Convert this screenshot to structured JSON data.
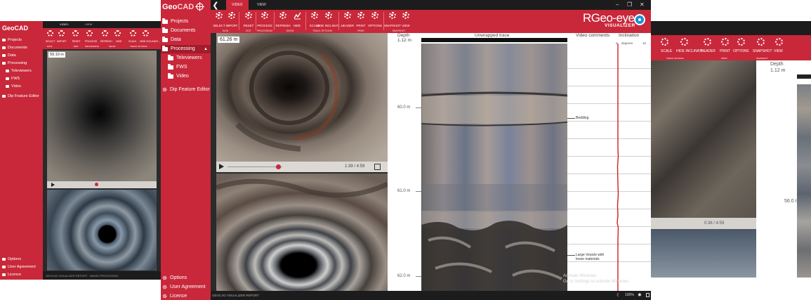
{
  "colors": {
    "brand_red": "#c8283a",
    "dark_bg": "#2b2b2b",
    "accent_blue": "#1e8fd6"
  },
  "left_window": {
    "logo": "GeoCAD",
    "nav": [
      "Projects",
      "Documents",
      "Data",
      "Processing",
      "Televiewers",
      "FWS",
      "Video",
      "Dip Feature Editor",
      "Options",
      "User Agreement",
      "Licence"
    ],
    "tabs": [
      "VIDEO",
      "VIEW"
    ],
    "toolbar": [
      "SELECT",
      "IMPORT",
      "RESET",
      "PROCESS",
      "REFRESH",
      "HIDE",
      "SCALE",
      "HIDE INCLINATI..."
    ],
    "toolbar_groups": [
      "DATA",
      "EDIT",
      "PROCESSING",
      "SHOW",
      "TRACK OPTIONS"
    ],
    "depth_badge": "59.10 m",
    "footer": "GEOCAD VISUALIZER REPORT · IMAGE PROCESSING"
  },
  "right_window": {
    "toolbar": [
      "SCALE",
      "HIDE INCLINATI...",
      "HEADER",
      "PRINT",
      "OPTIONS",
      "SNAPSHOT",
      "VIEW"
    ],
    "toolbar_groups": [
      "TRACK OPTIONS",
      "PRINT",
      "SNAPSHOT"
    ],
    "depth_header": "Depth",
    "depth_value": "1.12 m",
    "depth_tick": "56.0 m",
    "video_time": "0:36 / 4:59"
  },
  "main": {
    "logo_geo": "Geo",
    "logo_cad": "CAD",
    "sidebar": {
      "projects": "Projects",
      "documents": "Documents",
      "data": "Data",
      "processing": "Processing",
      "televiewers": "Televiewers",
      "fws": "FWS",
      "video": "Video",
      "dip_editor": "Dip Feature Editor",
      "options": "Options",
      "user_agreement": "User Agreement",
      "licence": "Licence"
    },
    "tabs": {
      "video": "VIDEO",
      "view": "VIEW"
    },
    "toolbar": {
      "select": "SELECT",
      "import": "IMPORT",
      "reset": "RESET",
      "process": "PROCESS",
      "refresh": "REFRESH",
      "hide": "HIDE",
      "scale": "SCALE",
      "hide_incl": "HIDE INCLINATI...",
      "header": "HEADER",
      "print": "PRINT",
      "options": "OPTIONS",
      "snapshot": "SNAPSHOT",
      "view": "VIEW"
    },
    "toolbar_groups": {
      "data": "DATA",
      "edit": "EDIT",
      "processing": "PROCESSING",
      "show": "SHOW",
      "track_options": "TRACK OPTIONS",
      "print": "PRINT",
      "snapshot": "SNAPSHOT"
    },
    "brand": {
      "name": "RGeo-eye",
      "sub": "VISUALIZER"
    },
    "video": {
      "depth_badge": "61.26 m",
      "time": "1:39 / 4:59"
    },
    "log": {
      "depth_header": "Depth",
      "depth_value": "1.12 m",
      "trace_header": "Unwrapped trace",
      "comments_header": "Video comments",
      "incl_header": "Inclination",
      "incl_axis_min": "0",
      "incl_axis_unit": "degrees",
      "incl_axis_max": "10",
      "depth_ticks": [
        "60.0 m",
        "61.0 m",
        "62.0 m"
      ],
      "comments": [
        "Bedding",
        "Large Vesicle with loose materials"
      ],
      "watermark_1": "Activate Windows",
      "watermark_2": "Go to Settings to activate Windows."
    },
    "footer": "GEOCAD VISUALIZER REPORT",
    "zoom": "100%"
  }
}
